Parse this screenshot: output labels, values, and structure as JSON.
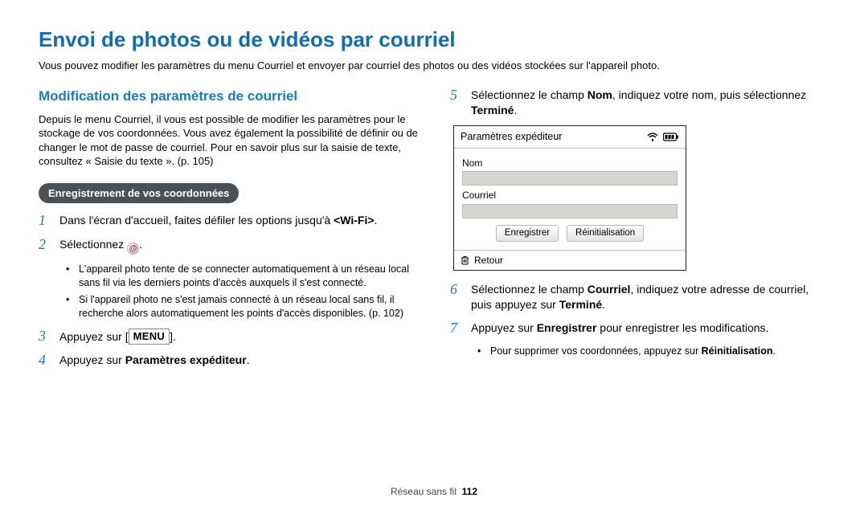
{
  "title": "Envoi de photos ou de vidéos par courriel",
  "intro": "Vous pouvez modifier les paramètres du menu Courriel et envoyer par courriel des photos ou des vidéos stockées sur l'appareil photo.",
  "left": {
    "subhead": "Modification des paramètres de courriel",
    "desc": "Depuis le menu Courriel, il vous est possible de modifier les paramètres pour le stockage de vos coordonnées. Vous avez également la possibilité de définir ou de changer le mot de passe de courriel. Pour en savoir plus sur la saisie de texte, consultez « Saisie du texte ». (p. 105)",
    "pill": "Enregistrement de vos coordonnées",
    "step1_a": "Dans l'écran d'accueil, faites défiler les options jusqu'à ",
    "step1_b": "<Wi-Fi>",
    "step1_c": ".",
    "step2_a": "Sélectionnez ",
    "step2_b": ".",
    "bullet2a": "L'appareil photo tente de se connecter automatiquement à un réseau local sans fil via les derniers points d'accès auxquels il s'est connecté.",
    "bullet2b": "Si l'appareil photo ne s'est jamais connecté à un réseau local sans fil, il recherche alors automatiquement les points d'accès disponibles. (p. 102)",
    "step3_a": "Appuyez sur [",
    "step3_menu": "MENU",
    "step3_b": "].",
    "step4_a": "Appuyez sur ",
    "step4_b": "Paramètres expéditeur",
    "step4_c": "."
  },
  "right": {
    "step5_a": "Sélectionnez le champ ",
    "step5_b": "Nom",
    "step5_c": ", indiquez votre nom, puis sélectionnez ",
    "step5_d": "Terminé",
    "step5_e": ".",
    "step6_a": "Sélectionnez le champ ",
    "step6_b": "Courriel",
    "step6_c": ", indiquez votre adresse de courriel, puis appuyez sur ",
    "step6_d": "Terminé",
    "step6_e": ".",
    "step7_a": "Appuyez sur ",
    "step7_b": "Enregistrer",
    "step7_c": " pour enregistrer les modifications.",
    "bullet7_a": "Pour supprimer vos coordonnées, appuyez sur ",
    "bullet7_b": "Réinitialisation",
    "bullet7_c": "."
  },
  "device": {
    "title": "Paramètres expéditeur",
    "label_nom": "Nom",
    "label_courriel": "Courriel",
    "btn_save": "Enregistrer",
    "btn_reset": "Réinitialisation",
    "btn_back": "Retour"
  },
  "footer": {
    "section": "Réseau sans fil",
    "page": "112"
  }
}
